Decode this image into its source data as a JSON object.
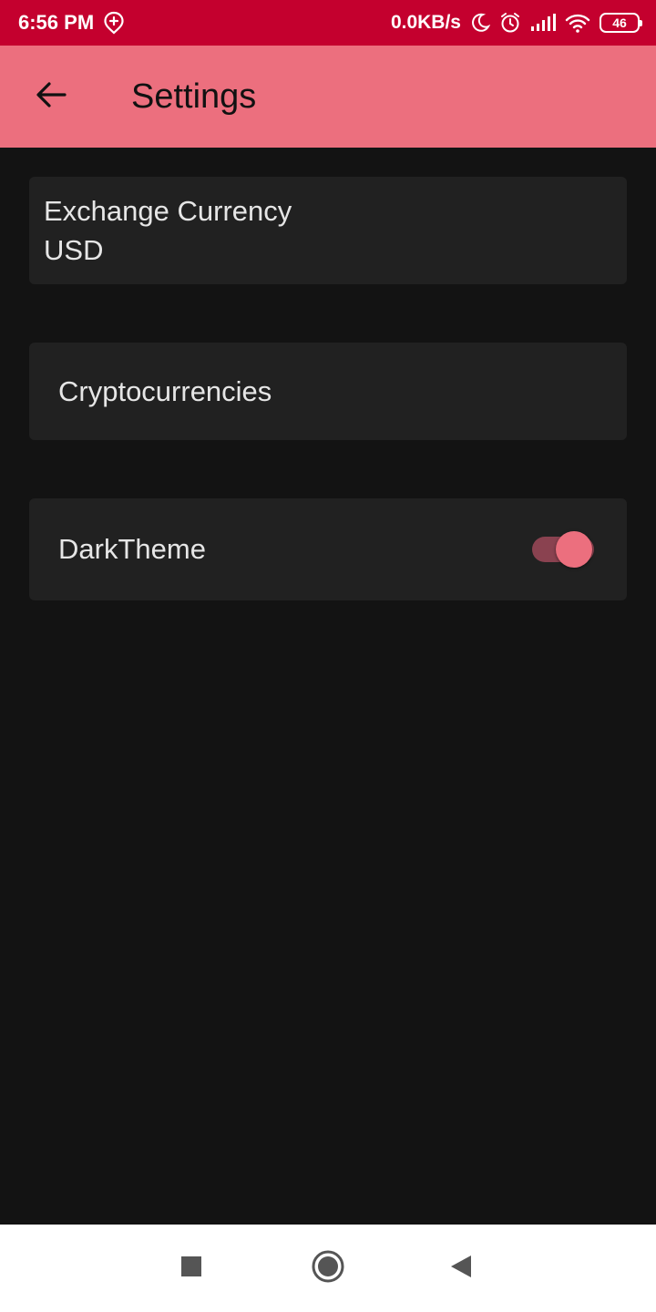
{
  "status_bar": {
    "time": "6:56 PM",
    "network_speed": "0.0KB/s",
    "battery_level": "46",
    "background": "#c4002e",
    "icons": [
      "location-plus-icon",
      "moon-icon",
      "alarm-icon",
      "signal-icon",
      "wifi-icon",
      "battery-icon"
    ]
  },
  "app_bar": {
    "title": "Settings",
    "back_icon": "arrow-back-icon",
    "background": "#ec6f7e"
  },
  "settings": {
    "exchange_currency": {
      "title": "Exchange Currency",
      "value": "USD"
    },
    "cryptocurrencies": {
      "label": "Cryptocurrencies"
    },
    "dark_theme": {
      "label": "DarkTheme",
      "enabled": true,
      "accent": "#ec6f7e"
    }
  },
  "nav_bar": {
    "icons": [
      "recents-square-icon",
      "home-circle-icon",
      "back-triangle-icon"
    ]
  },
  "colors": {
    "background": "#131313",
    "card": "#212121",
    "text": "#e6e6e6"
  }
}
